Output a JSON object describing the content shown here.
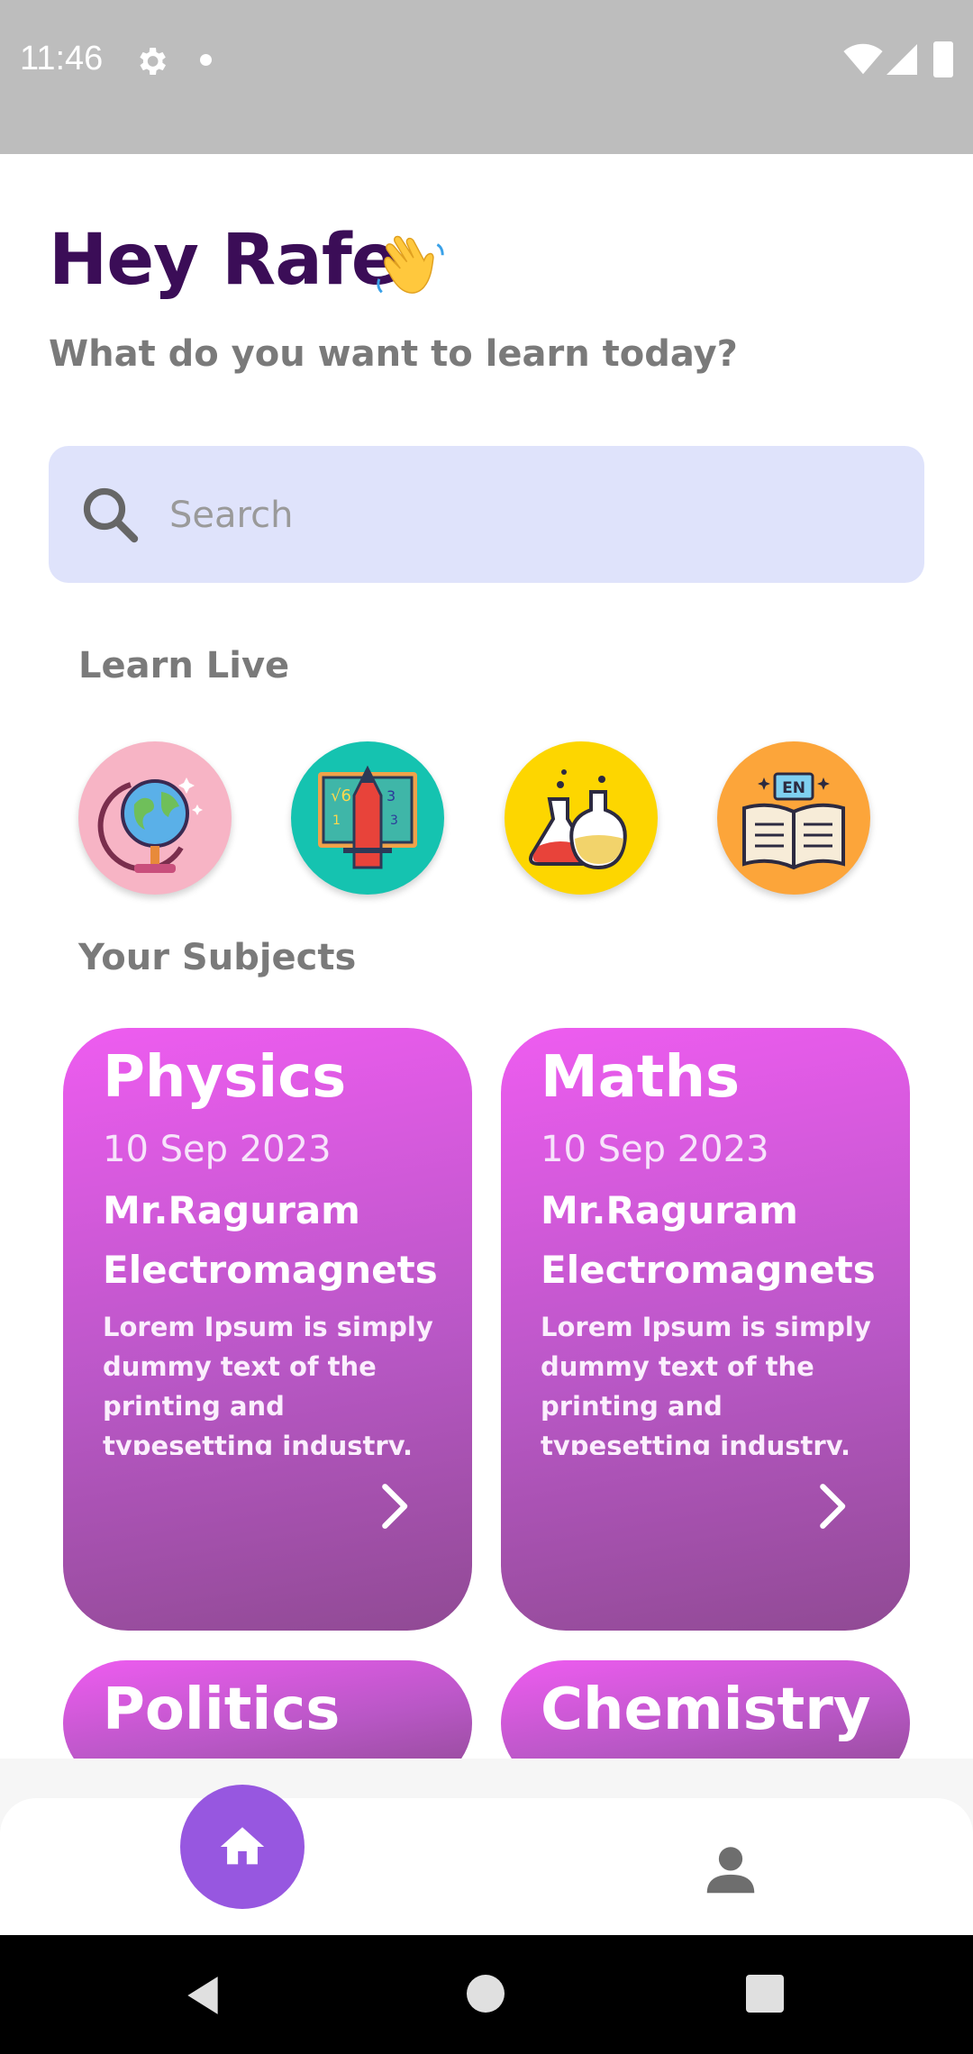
{
  "status_bar": {
    "time": "11:46"
  },
  "greeting": {
    "title": "Hey Rafe",
    "subtitle": "What do you want to learn today?"
  },
  "search": {
    "placeholder": "Search"
  },
  "learn_live": {
    "title": "Learn Live",
    "items": [
      {
        "icon": "globe-icon",
        "color": "#f7b4c5"
      },
      {
        "icon": "math-board-icon",
        "color": "#15c3b0"
      },
      {
        "icon": "chemistry-flasks-icon",
        "color": "#fdd600"
      },
      {
        "icon": "english-book-icon",
        "color": "#fca53a"
      }
    ]
  },
  "subjects": {
    "title": "Your Subjects",
    "cards": [
      {
        "title": "Physics",
        "date": "10 Sep 2023",
        "teacher": "Mr.Raguram",
        "topic": "Electromagnets",
        "description": "Lorem Ipsum is simply dummy text of the printing and typesetting industry. Lorem Ipsum"
      },
      {
        "title": "Maths",
        "date": "10 Sep 2023",
        "teacher": "Mr.Raguram",
        "topic": "Electromagnets",
        "description": "Lorem Ipsum is simply dummy text of the printing and typesetting industry. Lorem Ipsum"
      },
      {
        "title": "Politics"
      },
      {
        "title": "Chemistry"
      }
    ]
  },
  "colors": {
    "greeting_text": "#3b0d57",
    "search_bg": "#dfe3fb",
    "card_gradient_top": "#ee5cf0",
    "card_gradient_bottom": "#904a94",
    "home_button": "#9757e0"
  }
}
